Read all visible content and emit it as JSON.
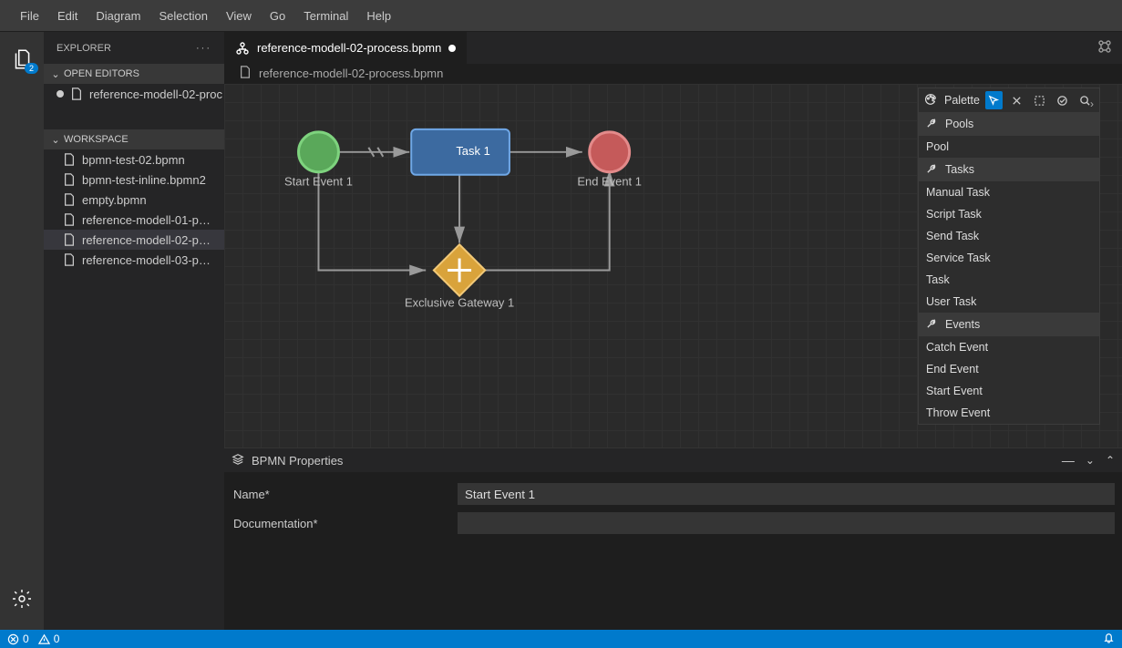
{
  "menubar": {
    "items": [
      "File",
      "Edit",
      "Diagram",
      "Selection",
      "View",
      "Go",
      "Terminal",
      "Help"
    ]
  },
  "activitybar": {
    "explorer_badge": "2"
  },
  "sidebar": {
    "title": "EXPLORER",
    "open_editors_label": "OPEN EDITORS",
    "workspace_label": "WORKSPACE",
    "open_editor_item": "reference-modell-02-proc",
    "files": [
      "bpmn-test-02.bpmn",
      "bpmn-test-inline.bpmn2",
      "empty.bpmn",
      "reference-modell-01-p…",
      "reference-modell-02-p…",
      "reference-modell-03-p…"
    ],
    "selected_index": 4
  },
  "tab": {
    "label": "reference-modell-02-process.bpmn",
    "dirty": true
  },
  "breadcrumb": {
    "label": "reference-modell-02-process.bpmn"
  },
  "diagram": {
    "start_label": "Start Event 1",
    "task_label": "Task 1",
    "end_label": "End Event 1",
    "gateway_label": "Exclusive Gateway 1",
    "colors": {
      "start_fill": "#5aa85a",
      "start_stroke": "#7ed37e",
      "end_fill": "#c55a5a",
      "end_stroke": "#e38a8a",
      "task_fill": "#3c6aa0",
      "task_stroke": "#6fa7e6",
      "gateway_fill": "#d9a33b",
      "gateway_stroke": "#f2c978",
      "connector": "#9a9a9a",
      "label": "#bfbfbf"
    }
  },
  "palette": {
    "title": "Palette",
    "groups": [
      {
        "label": "Pools",
        "items": [
          "Pool"
        ]
      },
      {
        "label": "Tasks",
        "items": [
          "Manual Task",
          "Script Task",
          "Send Task",
          "Service Task",
          "Task",
          "User Task"
        ]
      },
      {
        "label": "Events",
        "items": [
          "Catch Event",
          "End Event",
          "Start Event",
          "Throw Event"
        ]
      }
    ]
  },
  "properties": {
    "title": "BPMN Properties",
    "rows": [
      {
        "label": "Name*",
        "value": "Start Event 1"
      },
      {
        "label": "Documentation*",
        "value": ""
      }
    ]
  },
  "statusbar": {
    "errors": "0",
    "warnings": "0"
  }
}
